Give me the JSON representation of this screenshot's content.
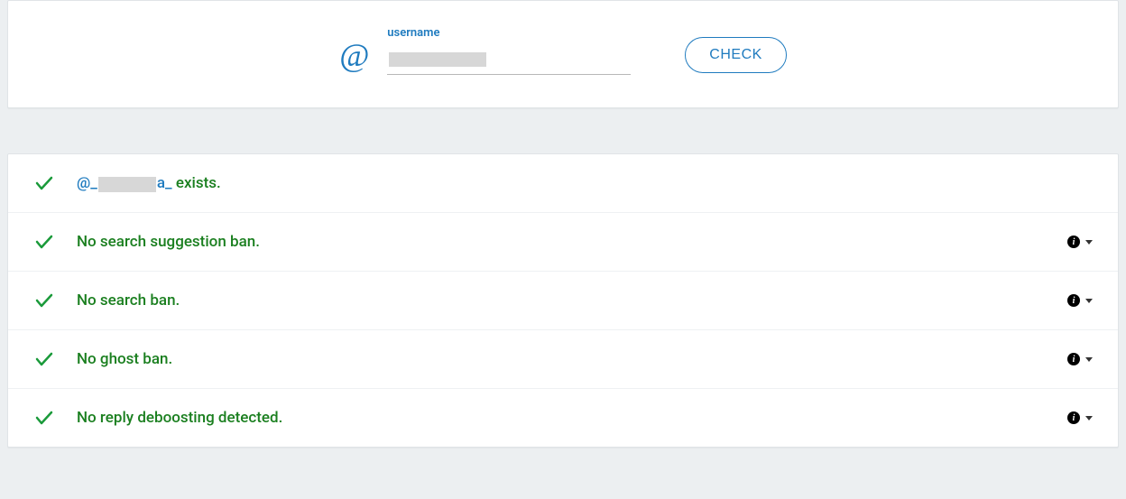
{
  "search": {
    "label": "username",
    "at": "@",
    "button": "CHECK"
  },
  "results": {
    "rows": [
      {
        "prefix": "@_",
        "suffix": "a_",
        "tail": " exists.",
        "link_style": true,
        "info": false
      },
      {
        "text": "No search suggestion ban.",
        "info": true
      },
      {
        "text": "No search ban.",
        "info": true
      },
      {
        "text": "No ghost ban.",
        "info": true
      },
      {
        "text": "No reply deboosting detected.",
        "info": true
      }
    ]
  }
}
